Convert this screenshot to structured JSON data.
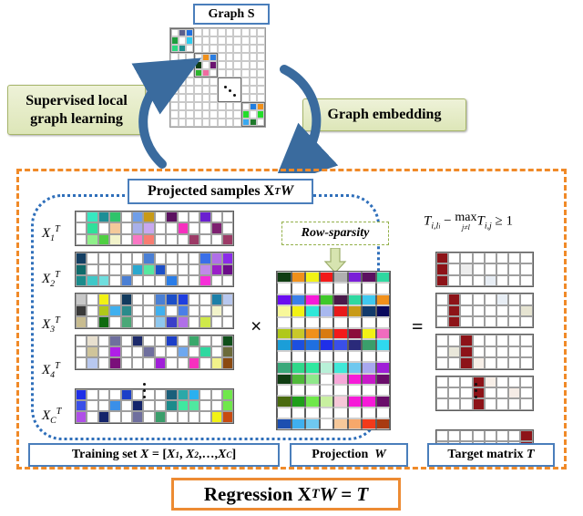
{
  "title": "Supervised local graph learning and graph embedding regression framework",
  "labels": {
    "graph_s": "Graph S",
    "supervised": "Supervised local\ngraph learning",
    "supervised_line1": "Supervised local",
    "supervised_line2": "graph learning",
    "graph_embedding": "Graph embedding",
    "projected_samples": "Projected samples X",
    "projected_samples_sup": "T",
    "projected_samples_tail": "W",
    "row_sparsity": "Row-sparsity",
    "training_set": "Training set X = [X",
    "training_set_full": "Training set X = [X1, X2,…,XC]",
    "projection": "Projection  W",
    "target_matrix": "Target matrix T",
    "regression": "Regression X",
    "regression_sup": "T",
    "regression_tail": "W = T",
    "constraint": "T i,li − max j≠li T i,j ≥ 1"
  },
  "constraint_parts": {
    "t1_base": "T",
    "t1_sub": "i,l",
    "t1_subsub": "i",
    "minus": "−",
    "max": "max",
    "max_sub": "j≠l",
    "max_subsub": "i",
    "t2_base": "T",
    "t2_sub": "i,j",
    "geq": "≥ 1"
  },
  "row_labels": {
    "x1": "X",
    "x1_sub": "1",
    "x2": "X",
    "x2_sub": "2",
    "x3": "X",
    "x3_sub": "3",
    "x4": "X",
    "x4_sub": "4",
    "xc": "X",
    "xc_sub": "C",
    "sup_T": "T"
  },
  "operators": {
    "times": "×",
    "equals": "="
  },
  "colors": {
    "orange_frame": "#f08a28",
    "blue_frame": "#2f6fba",
    "box_blue": "#4a7ebb",
    "green_box_border": "#a6b56a",
    "arrow_blue": "#3a6b9e",
    "target_red": "#8d1318",
    "sparsity_arrow": "#cfe0a8"
  },
  "chart_data": {
    "type": "heatmap",
    "graph_s": {
      "size": 12,
      "note": "Block-diagonal similarity matrix with 4 visible 3x3 colored blocks along the diagonal and an ellipsis block",
      "blocks": [
        {
          "index": 1,
          "row": 0,
          "col": 0,
          "cells": [
            [
              "#ffffff",
              "#5b5f8c",
              "#1f6fe0"
            ],
            [
              "#1e9e3e",
              "#ffffff",
              "#2ecdf0"
            ],
            [
              "#2bd97e",
              "#1d8f8f",
              "#ffffff"
            ]
          ]
        },
        {
          "index": 2,
          "row": 3,
          "col": 3,
          "cells": [
            [
              "#ffffff",
              "#f0901b",
              "#2a7de1"
            ],
            [
              "#0f3d12",
              "#ffffff",
              "#6b1570"
            ],
            [
              "#2cb52c",
              "#f06ba0",
              "#ffffff"
            ]
          ]
        },
        {
          "index": 3,
          "row": 6,
          "col": 6,
          "cells": [
            [
              "#ffffff",
              "#ffffff",
              "#ffffff"
            ],
            [
              "#ffffff",
              "#ffffff",
              "#ffffff"
            ],
            [
              "#ffffff",
              "#ffffff",
              "#ffffff"
            ]
          ],
          "ellipsis": true
        },
        {
          "index": 4,
          "row": 9,
          "col": 9,
          "cells": [
            [
              "#ffffff",
              "#1f7de0",
              "#f0901b"
            ],
            [
              "#23dd2a",
              "#ffffff",
              "#23dd2a"
            ],
            [
              "#39a8f0",
              "#1f7a2b",
              "#ffffff"
            ]
          ]
        }
      ]
    },
    "matrix_X": {
      "rows_per_block": 3,
      "cols": 14,
      "blocks": 5,
      "block_labels": [
        "X1T",
        "X2T",
        "X3T",
        "X4T",
        "XCT"
      ],
      "data": [
        [
          [
            "#ffffff",
            "#36e8c0",
            "#1d8f96",
            "#2fc46b",
            "#ffffff",
            "#6f9ee8",
            "#c89a17",
            "#ffffff",
            "#5b1060",
            "#ffffff",
            "#ffffff",
            "#6a1fd0",
            "#ffffff",
            "#ffffff"
          ],
          [
            "#ffffff",
            "#2fe09b",
            "#ffffff",
            "#f4c99a",
            "#ffffff",
            "#a8b0ea",
            "#c8a8ef",
            "#ffffff",
            "#ffffff",
            "#f62fbe",
            "#ffffff",
            "#ffffff",
            "#7d2070",
            "#ffffff"
          ],
          [
            "#ffffff",
            "#8ff08a",
            "#4fcf42",
            "#f2f3ca",
            "#ffffff",
            "#f977c4",
            "#f87d72",
            "#ffffff",
            "#ffffff",
            "#ffffff",
            "#9c3a66",
            "#ffffff",
            "#ffffff",
            "#9c3a66"
          ]
        ],
        [
          [
            "#143f63",
            "#ffffff",
            "#ffffff",
            "#ffffff",
            "#ffffff",
            "#ffffff",
            "#4a7fd4",
            "#ffffff",
            "#ffffff",
            "#ffffff",
            "#ffffff",
            "#3a6fe8",
            "#b06fe8",
            "#8a2be8"
          ],
          [
            "#106b6b",
            "#ffffff",
            "#ffffff",
            "#ffffff",
            "#ffffff",
            "#2aa8cf",
            "#56e8a0",
            "#1c4fc8",
            "#ffffff",
            "#ffffff",
            "#ffffff",
            "#c08ae8",
            "#9a1fc8",
            "#6a0d88"
          ],
          [
            "#1b8b8b",
            "#3fc8c8",
            "#6fdede",
            "#ffffff",
            "#4a7fd4",
            "#ffffff",
            "#ffffff",
            "#ffffff",
            "#2a7de8",
            "#ffffff",
            "#ffffff",
            "#f62fd8",
            "#ffffff",
            "#ffffff"
          ]
        ],
        [
          [
            "#c8c8c8",
            "#ffffff",
            "#f2f215",
            "#ffffff",
            "#123a5e",
            "#ffffff",
            "#ffffff",
            "#4a7fd4",
            "#1c4fc8",
            "#1f3fe0",
            "#ffffff",
            "#ffffff",
            "#1b7fa8",
            "#b8c8ef"
          ],
          [
            "#3a3a3a",
            "#ffffff",
            "#b0c81b",
            "#3fb0ef",
            "#2a8b8b",
            "#ffffff",
            "#ffffff",
            "#3fb0ef",
            "#ffffff",
            "#4a7fe8",
            "#ffffff",
            "#ffffff",
            "#f2f3ca",
            "#ffffff"
          ],
          [
            "#c8bc90",
            "#ffffff",
            "#0f6b10",
            "#ffffff",
            "#4aa878",
            "#ffffff",
            "#ffffff",
            "#8fc8ef",
            "#3a3fc8",
            "#b06fe8",
            "#ffffff",
            "#cfe84a",
            "#ffffff",
            "#ffffff"
          ]
        ],
        [
          [
            "#ffffff",
            "#e8e0cf",
            "#ffffff",
            "#6f6f9e",
            "#ffffff",
            "#1c2a6b",
            "#ffffff",
            "#ffffff",
            "#1c3fc8",
            "#ffffff",
            "#3aa86b",
            "#ffffff",
            "#ffffff",
            "#0f4f1a"
          ],
          [
            "#ffffff",
            "#cfc49a",
            "#ffffff",
            "#b01fe8",
            "#ffffff",
            "#ffffff",
            "#6f6f9e",
            "#ffffff",
            "#ffffff",
            "#6fa8ef",
            "#ffffff",
            "#2fd8a0",
            "#ffffff",
            "#6b6b3a"
          ],
          [
            "#ffffff",
            "#b8c8ef",
            "#ffffff",
            "#7a0f7a",
            "#ffffff",
            "#ffffff",
            "#ffffff",
            "#a01fd8",
            "#ffffff",
            "#ffffff",
            "#f62fbe",
            "#ffffff",
            "#f2f28a",
            "#8b4a10"
          ]
        ],
        [
          [
            "#1f2fe8",
            "#ffffff",
            "#ffffff",
            "#ffffff",
            "#1c3fc8",
            "#ffffff",
            "#ffffff",
            "#ffffff",
            "#1b5f7a",
            "#2aa8a8",
            "#2ab0ef",
            "#ffffff",
            "#ffffff",
            "#6fe84a"
          ],
          [
            "#3a4fe8",
            "#ffffff",
            "#ffffff",
            "#3a8fe8",
            "#ffffff",
            "#14246b",
            "#ffffff",
            "#ffffff",
            "#1b8b8b",
            "#3fe8a0",
            "#4fe8a0",
            "#ffffff",
            "#ffffff",
            "#6fe84a"
          ],
          [
            "#b04fe8",
            "#ffffff",
            "#14246b",
            "#ffffff",
            "#ffffff",
            "#6f6f9e",
            "#ffffff",
            "#3a9e6b",
            "#ffffff",
            "#ffffff",
            "#ffffff",
            "#ffffff",
            "#f2f215",
            "#c84a10"
          ]
        ]
      ]
    },
    "matrix_W": {
      "rows": 14,
      "cols": 8,
      "note": "Row-sparse projection matrix: entire rows are either colored (selected) or white (suppressed)",
      "rows_data": [
        [
          "#0f3d12",
          "#f0901b",
          "#f2f215",
          "#f21a1a",
          "#b0b0b0",
          "#7a1fd8",
          "#5b1060",
          "#2fd8a0"
        ],
        [
          "#ffffff",
          "#ffffff",
          "#ffffff",
          "#ffffff",
          "#ffffff",
          "#ffffff",
          "#ffffff",
          "#ffffff"
        ],
        [
          "#6a0df0",
          "#3a7fe8",
          "#f61ad8",
          "#3fc82a",
          "#4a1a4a",
          "#2fd8a0",
          "#3fc8ef",
          "#f0901b"
        ],
        [
          "#f8f89a",
          "#f2f215",
          "#2fe8d8",
          "#a8b8ef",
          "#e81a1a",
          "#c89a17",
          "#123a6b",
          "#0a0a5e"
        ],
        [
          "#ffffff",
          "#ffffff",
          "#ffffff",
          "#ffffff",
          "#ffffff",
          "#ffffff",
          "#ffffff",
          "#ffffff"
        ],
        [
          "#b0c81b",
          "#c8c82a",
          "#f0901b",
          "#d87a10",
          "#f21a1a",
          "#8b0d3a",
          "#f2f215",
          "#f06bbe"
        ],
        [
          "#1b9ed8",
          "#1c4fe0",
          "#1f6fe0",
          "#1f2fe8",
          "#3a4fe8",
          "#2a2a7a",
          "#3a9e6b",
          "#2fd8ef"
        ],
        [
          "#ffffff",
          "#ffffff",
          "#ffffff",
          "#ffffff",
          "#ffffff",
          "#ffffff",
          "#ffffff",
          "#ffffff"
        ],
        [
          "#3aa87a",
          "#2fd88a",
          "#2fe8a0",
          "#b8f0d8",
          "#3fe8d8",
          "#6fc8ef",
          "#a8a8ef",
          "#a01fd8"
        ],
        [
          "#0f3d12",
          "#4fb83a",
          "#8fe88a",
          "#ffffff",
          "#f6a8d8",
          "#f61ad8",
          "#c81ac8",
          "#6a0d6a"
        ],
        [
          "#ffffff",
          "#ffffff",
          "#ffffff",
          "#ffffff",
          "#ffffff",
          "#ffffff",
          "#ffffff",
          "#ffffff"
        ],
        [
          "#4a6b0f",
          "#1f9e1a",
          "#6fe84a",
          "#c8f0a0",
          "#f6c8d8",
          "#f61ad8",
          "#f61ad8",
          "#6a0d6a"
        ],
        [
          "#ffffff",
          "#ffffff",
          "#ffffff",
          "#ffffff",
          "#ffffff",
          "#ffffff",
          "#ffffff",
          "#ffffff"
        ],
        [
          "#1c4fb0",
          "#3fb0ef",
          "#6fc8ef",
          "#ffffff",
          "#f6c89a",
          "#f6a86b",
          "#f23a1a",
          "#a83a10"
        ]
      ]
    },
    "matrix_T": {
      "rows_per_block": 3,
      "cols": 8,
      "blocks": 5,
      "note": "Target matrix: each class block has one dark-red column at its class index; last block marks the final column",
      "highlight_col": [
        0,
        1,
        2,
        3,
        7
      ],
      "highlight_color": "#8d1318"
    }
  }
}
